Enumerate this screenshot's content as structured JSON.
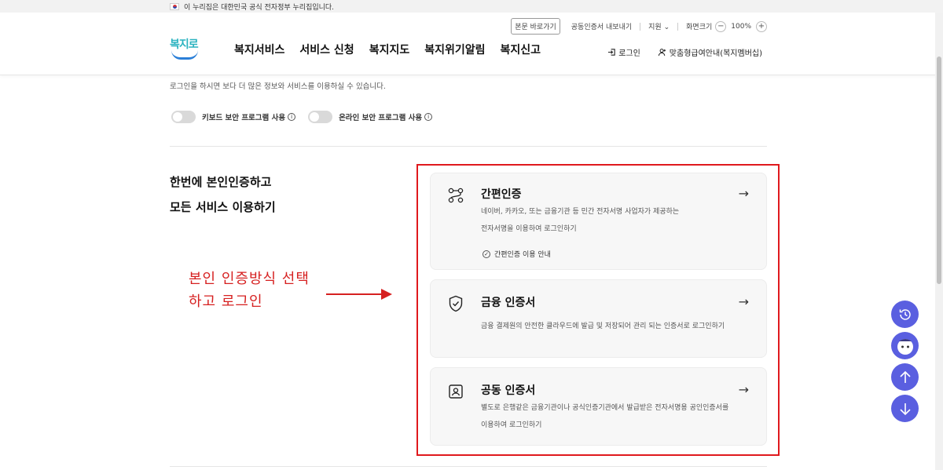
{
  "gov_banner": {
    "text": "이 누리집은 대한민국 공식 전자정부 누리집입니다."
  },
  "util": {
    "skip_label": "본문 바로가기",
    "cert_export": "공동인증서 내보내기",
    "support": "지원",
    "zoom_label": "화면크기",
    "zoom_value": "100%"
  },
  "logo": {
    "text": "복지로"
  },
  "gnb": [
    "복지서비스",
    "서비스 신청",
    "복지지도",
    "복지위기알림",
    "복지신고"
  ],
  "right_links": {
    "login": "로그인",
    "member": "맞춤형급여안내(복지멤버십)"
  },
  "desc": "로그인을 하시면 보다 더 많은 정보와 서비스를 이용하실 수 있습니다.",
  "toggles": [
    {
      "label": "키보드 보안 프로그램 사용",
      "on": false
    },
    {
      "label": "온라인 보안 프로그램 사용",
      "on": false
    }
  ],
  "left_title": {
    "line1": "한번에 본인인증하고",
    "line2": "모든 서비스 이용하기"
  },
  "annotation": {
    "line1": "본인 인증방식 선택",
    "line2": "하고 로그인",
    "color": "#d62020"
  },
  "cards": [
    {
      "title": "간편인증",
      "desc_line1": "네이버, 카카오, 또는 금융기관 등 민간 전자서명 사업자가 제공하는",
      "desc_line2": "전자서명을 이용하여 로그인하기",
      "guide": "간편인증 이용 안내",
      "icon": "connection-icon"
    },
    {
      "title": "금융 인증서",
      "desc_line1": "금융 결제원의 안전한 클라우드에 발급 및 저장되어 관리 되는 인증서로 로그인하기",
      "icon": "shield-check-icon"
    },
    {
      "title": "공동 인증서",
      "desc_line1": "별도로 은행같은 금융기관이나 공식인증기관에서 발급받은 전자서명용 공인인증서를",
      "desc_line2": "이용하여 로그인하기",
      "icon": "id-card-icon"
    }
  ],
  "colors": {
    "accent": "#5a5fe0",
    "highlight": "#e0191d",
    "logo": "#2bb3c0"
  }
}
